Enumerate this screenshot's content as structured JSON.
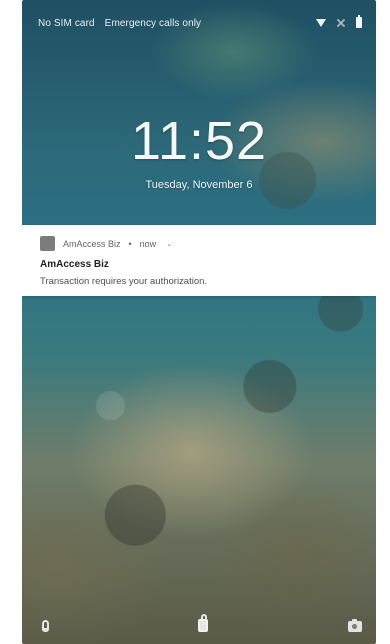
{
  "status_bar": {
    "carrier": "No SIM card",
    "emergency": "Emergency calls only",
    "icons": [
      "wifi-icon",
      "signal-off-icon",
      "battery-icon"
    ]
  },
  "lockscreen": {
    "time": "11:52",
    "date": "Tuesday, November 6"
  },
  "notification": {
    "app_icon": "app-icon",
    "app_name": "AmAccess Biz",
    "separator": "•",
    "age": "now",
    "expand_icon": "chevron-down-icon",
    "title": "AmAccess Biz",
    "body": "Transaction requires your authorization."
  },
  "bottom_actions": {
    "left": "mic-icon",
    "center": "lock-icon",
    "right": "camera-icon"
  },
  "colors": {
    "notification_background": "#ffffff",
    "text_primary": "#222222",
    "text_secondary": "#4f4f4f",
    "status_text": "#ffffff"
  }
}
